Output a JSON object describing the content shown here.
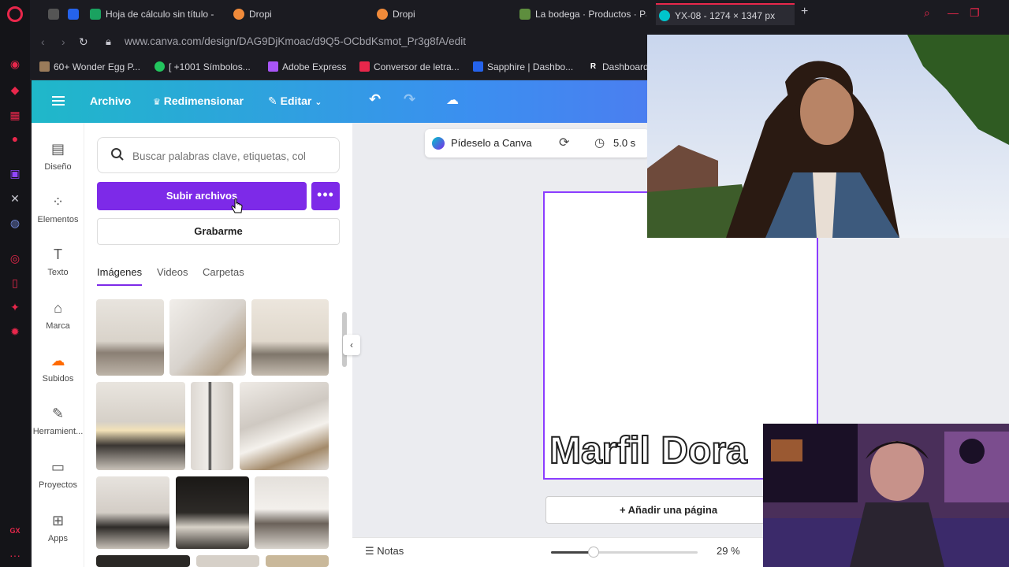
{
  "browser": {
    "tabs": [
      {
        "label": "Hoja de cálculo sin título -",
        "color": "#1aa260"
      },
      {
        "label": "Dropi",
        "color": "#f08a3a"
      },
      {
        "label": "Dropi",
        "color": "#f08a3a"
      },
      {
        "label": "La bodega · Productos · Pa",
        "color": "#5e8e3e"
      },
      {
        "label": "YX-08 - 1274 × 1347 px",
        "color": "#00c4cc"
      }
    ],
    "url": "www.canva.com/design/DAG9DjKmoac/d9Q5-OCbdKsmot_Pr3g8fA/edit",
    "bookmarks": [
      {
        "label": "60+ Wonder Egg P...",
        "color": "#9a7b5a"
      },
      {
        "label": "[ +1001 Símbolos...",
        "color": "#22c55e"
      },
      {
        "label": "Adobe Express",
        "color": "#a855f7"
      },
      {
        "label": "Conversor de letra...",
        "color": "#e8274b"
      },
      {
        "label": "Sapphire | Dashbo...",
        "color": "#2563eb"
      },
      {
        "label": "Dashboard",
        "color": "#ffffff"
      }
    ]
  },
  "header": {
    "file": "Archivo",
    "resize": "Redimensionar",
    "edit": "Editar"
  },
  "rail": [
    {
      "label": "Diseño",
      "icon": "layout-icon"
    },
    {
      "label": "Elementos",
      "icon": "shapes-icon"
    },
    {
      "label": "Texto",
      "icon": "text-icon"
    },
    {
      "label": "Marca",
      "icon": "brand-icon"
    },
    {
      "label": "Subidos",
      "icon": "cloud-upload-icon"
    },
    {
      "label": "Herramient...",
      "icon": "tools-icon"
    },
    {
      "label": "Proyectos",
      "icon": "folder-icon"
    },
    {
      "label": "Apps",
      "icon": "apps-icon"
    }
  ],
  "panel": {
    "search_placeholder": "Buscar palabras clave, etiquetas, col",
    "upload": "Subir archivos",
    "record": "Grabarme",
    "tabs": [
      "Imágenes",
      "Videos",
      "Carpetas"
    ]
  },
  "canvas": {
    "ai_prompt": "Pídeselo a Canva",
    "duration": "5.0 s",
    "page_text": "Marfil Dora",
    "add_page": "+ Añadir una página",
    "notes": "Notas",
    "zoom": "29 %",
    "zoom_level": 0.29
  }
}
